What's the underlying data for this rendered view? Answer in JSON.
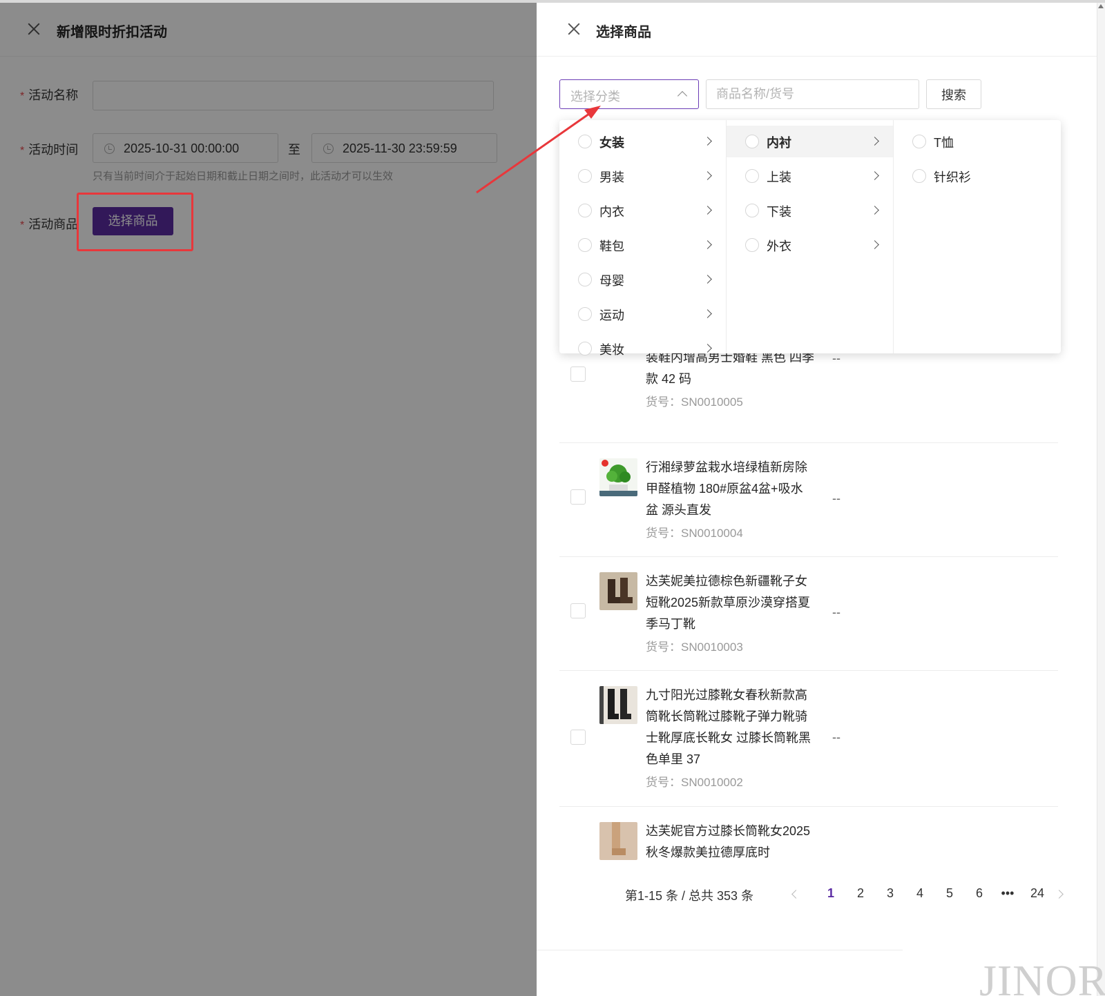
{
  "left_drawer": {
    "title": "新增限时折扣活动",
    "fields": {
      "name_label": "活动名称",
      "time_label": "活动时间",
      "start_time": "2025-10-31 00:00:00",
      "date_separator": "至",
      "end_time": "2025-11-30 23:59:59",
      "time_hint": "只有当前时间介于起始日期和截止日期之间时，此活动才可以生效",
      "goods_label": "活动商品",
      "select_goods_button": "选择商品",
      "required_mark": "*"
    }
  },
  "right_drawer": {
    "title": "选择商品",
    "category_placeholder": "选择分类",
    "search_placeholder": "商品名称/货号",
    "search_button": "搜索",
    "cascader": {
      "level1": [
        {
          "label": "女装",
          "active": true
        },
        {
          "label": "男装"
        },
        {
          "label": "内衣"
        },
        {
          "label": "鞋包"
        },
        {
          "label": "母婴"
        },
        {
          "label": "运动"
        },
        {
          "label": "美妆"
        }
      ],
      "level2": [
        {
          "label": "内衬",
          "active": true
        },
        {
          "label": "上装"
        },
        {
          "label": "下装"
        },
        {
          "label": "外衣"
        }
      ],
      "level3": [
        {
          "label": "T恤"
        },
        {
          "label": "针织衫"
        }
      ]
    },
    "products": [
      {
        "name": "装鞋内增高男士婚鞋 黑色 四季款 42 码",
        "sku": "货号：SN0010005",
        "price": "--"
      },
      {
        "name": "行湘绿萝盆栽水培绿植新房除甲醛植物 180#原盆4盆+吸水盆 源头直发",
        "sku": "货号：SN0010004",
        "price": "--"
      },
      {
        "name": "达芙妮美拉德棕色新疆靴子女短靴2025新款草原沙漠穿搭夏季马丁靴",
        "sku": "货号：SN0010003",
        "price": "--"
      },
      {
        "name": "九寸阳光过膝靴女春秋新款高筒靴长筒靴过膝靴子弹力靴骑士靴厚底长靴女 过膝长筒靴黑色单里 37",
        "sku": "货号：SN0010002",
        "price": "--"
      },
      {
        "name": "达芙妮官方过膝长筒靴女2025秋冬爆款美拉德厚底时",
        "sku": "",
        "price": ""
      }
    ],
    "pagination": {
      "total_text": "第1-15 条 / 总共 353 条",
      "pages": [
        "1",
        "2",
        "3",
        "4",
        "5",
        "6",
        "•••",
        "24"
      ],
      "current": "1"
    }
  },
  "watermark": "JINOR",
  "colors": {
    "accent": "#5b2ca3",
    "annotation": "#e8373b",
    "overlay": "rgba(0,0,0,0.45)"
  }
}
